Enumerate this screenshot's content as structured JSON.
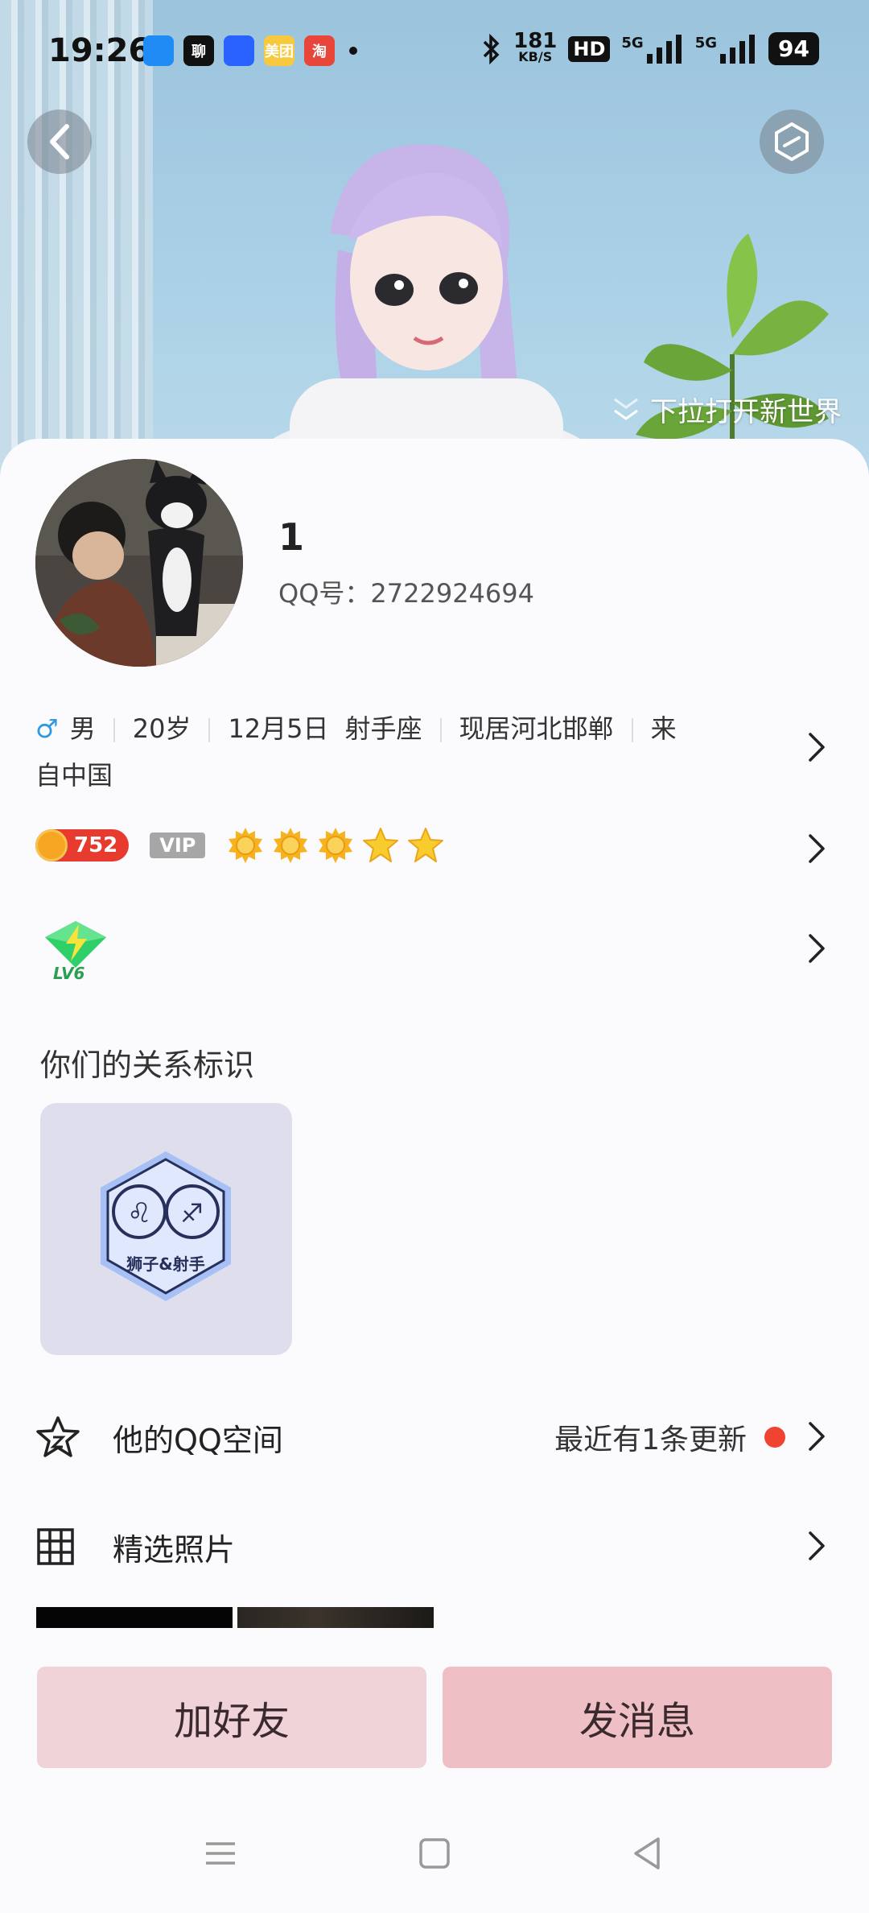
{
  "statusbar": {
    "time": "19:26",
    "app_icons": [
      {
        "name": "messages-icon",
        "text": "",
        "color": "#1f8bf5"
      },
      {
        "name": "chat-app-icon",
        "text": "聊",
        "color": "#111111"
      },
      {
        "name": "browser-icon",
        "text": "",
        "color": "#2962ff"
      },
      {
        "name": "meituan-icon",
        "text": "美团",
        "color": "#f7c93e"
      },
      {
        "name": "taobao-icon",
        "text": "淘",
        "color": "#e8463a"
      }
    ],
    "net_speed_value": "181",
    "net_speed_unit": "KB/S",
    "hd_label": "HD",
    "signal1_label": "5G",
    "signal2_label": "5G",
    "battery": "94"
  },
  "hero": {
    "pull_hint": "下拉打开新世界"
  },
  "profile": {
    "nickname": "1",
    "qq_label": "QQ号：",
    "qq_number": "2722924694",
    "gender_symbol": "♂",
    "gender": "男",
    "age": "20岁",
    "birthday": "12月5日",
    "zodiac": "射手座",
    "location": "现居河北邯郸",
    "hometown_prefix": "来",
    "hometown_rest": "自中国",
    "coin_value": "752",
    "vip_label": "VIP",
    "level_stars": [
      "sun",
      "sun",
      "sun",
      "star",
      "star"
    ],
    "badge_level": "LV6"
  },
  "relation": {
    "title": "你们的关系标识",
    "badge_text": "狮子&射手"
  },
  "menu": {
    "qzone_label": "他的QQ空间",
    "qzone_update": "最近有1条更新",
    "photos_label": "精选照片"
  },
  "actions": {
    "add_friend": "加好友",
    "send_message": "发消息",
    "add_friend_color": "#f0d3d8",
    "send_message_color": "#efbfc6"
  }
}
